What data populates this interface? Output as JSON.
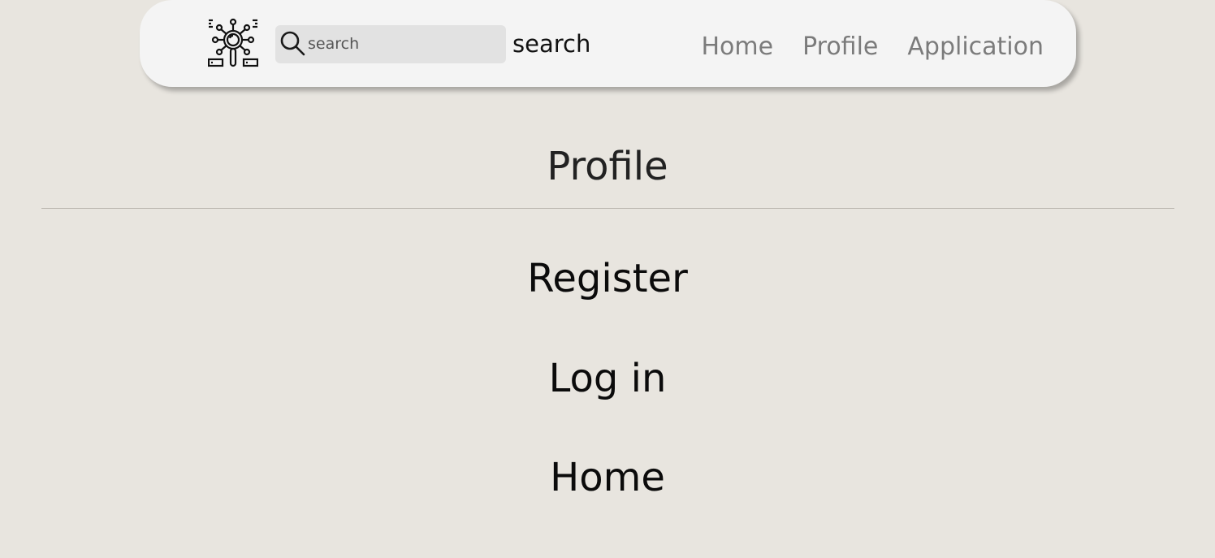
{
  "header": {
    "logo_icon": "data-search-icon",
    "search": {
      "placeholder": "search",
      "value": "",
      "icon": "search-icon",
      "button_label": "search"
    },
    "nav": [
      {
        "label": "Home"
      },
      {
        "label": "Profile"
      },
      {
        "label": "Application"
      }
    ]
  },
  "main": {
    "title": "Profile",
    "links": [
      {
        "label": "Register"
      },
      {
        "label": "Log in"
      },
      {
        "label": "Home"
      }
    ]
  },
  "colors": {
    "page_background": "#e8e5df",
    "navbar_background": "#f4f4f4",
    "search_background": "#e2e2e2",
    "nav_link": "#7b7b7b",
    "text": "#0b0b0b"
  }
}
